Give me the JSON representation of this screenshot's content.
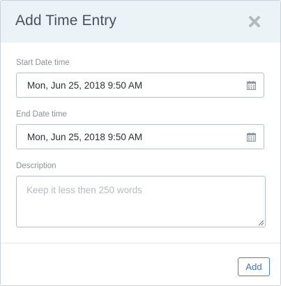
{
  "modal": {
    "title": "Add Time Entry",
    "close_icon": "close-icon"
  },
  "fields": {
    "start": {
      "label": "Start Date time",
      "value": "Mon, Jun 25, 2018 9:50 AM",
      "icon": "calendar-icon"
    },
    "end": {
      "label": "End Date time",
      "value": "Mon, Jun 25, 2018 9:50 AM",
      "icon": "calendar-icon"
    },
    "description": {
      "label": "Description",
      "value": "",
      "placeholder": "Keep it less then 250 words"
    }
  },
  "footer": {
    "add_label": "Add"
  },
  "colors": {
    "header_bg": "#ecf3f7",
    "accent": "#3f73b8",
    "border": "#b9c0c5"
  }
}
